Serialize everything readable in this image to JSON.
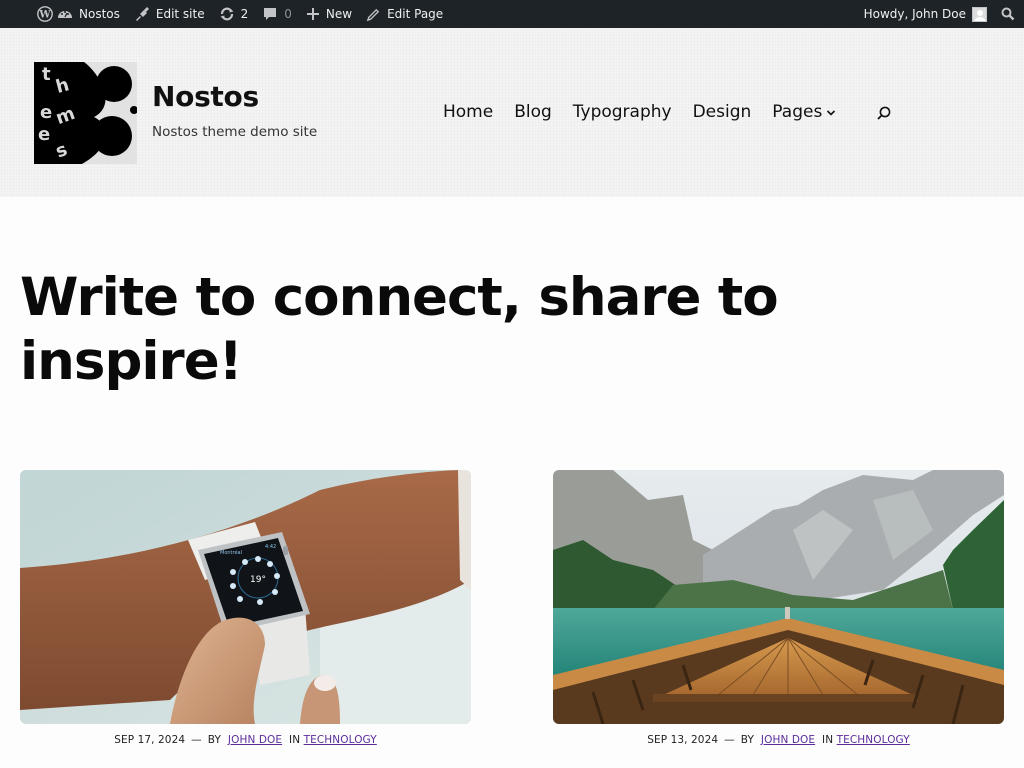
{
  "admin_bar": {
    "wp_logo_icon": "wordpress-icon",
    "site_name": "Nostos",
    "edit_site": "Edit site",
    "updates_count": "2",
    "comments_count": "0",
    "new_label": "New",
    "edit_page": "Edit Page",
    "howdy": "Howdy, John Doe"
  },
  "header": {
    "site_title": "Nostos",
    "tagline": "Nostos theme demo site",
    "logo_letters": [
      "t",
      "h",
      "e",
      "m",
      "e",
      "s"
    ],
    "nav": [
      {
        "label": "Home"
      },
      {
        "label": "Blog"
      },
      {
        "label": "Typography"
      },
      {
        "label": "Design"
      },
      {
        "label": "Pages",
        "has_submenu": true
      }
    ]
  },
  "main": {
    "headline": "Write to connect, share to inspire!",
    "posts": [
      {
        "image_alt": "Person tapping a smartwatch on wrist",
        "date": "SEP 17, 2024",
        "by": "BY",
        "author": "JOHN DOE",
        "in": "IN",
        "category": "TECHNOLOGY",
        "watch_city": "Montréal",
        "watch_time": "4:42",
        "watch_temp": "19°"
      },
      {
        "image_alt": "Wooden boat bow on a turquoise mountain lake",
        "date": "SEP 13, 2024",
        "by": "BY",
        "author": "JOHN DOE",
        "in": "IN",
        "category": "TECHNOLOGY"
      }
    ],
    "meta_separator": "—"
  },
  "colors": {
    "admin_bar_bg": "#1d2327",
    "link": "#5b2d9c",
    "header_bg": "#f4f4f4"
  }
}
